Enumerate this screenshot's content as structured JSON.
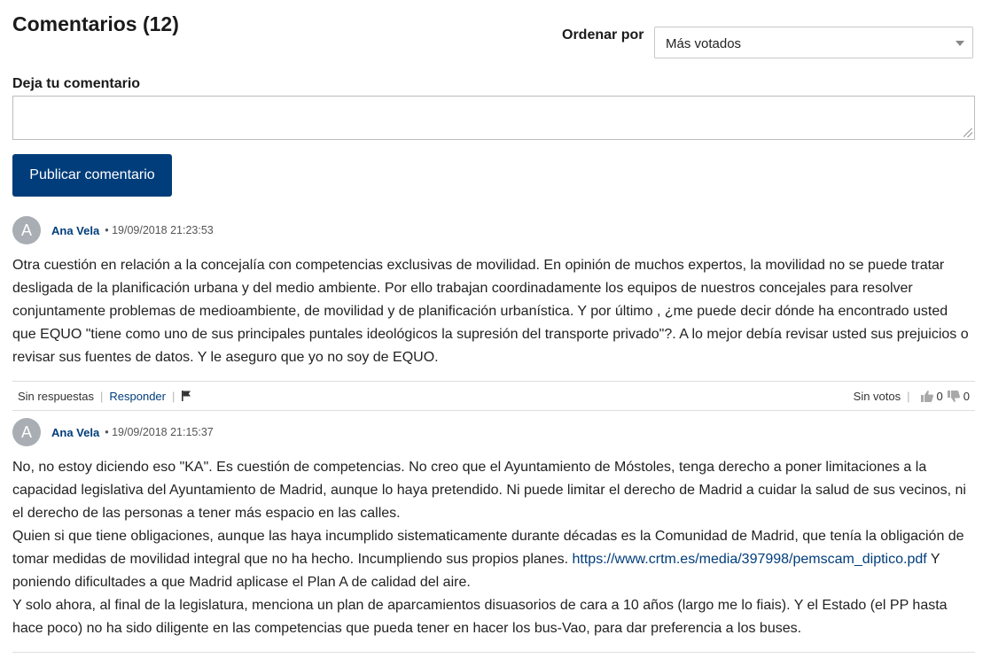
{
  "header": {
    "title": "Comentarios (12)",
    "sort_label": "Ordenar por",
    "sort_value": "Más votados"
  },
  "form": {
    "label": "Deja tu comentario",
    "value": "",
    "submit_label": "Publicar comentario"
  },
  "comments": [
    {
      "avatar_initial": "A",
      "author": "Ana Vela",
      "date": "19/09/2018 21:23:53",
      "body": "Otra cuestión en relación a la concejalía con competencias exclusivas de movilidad. En opinión de muchos expertos, la movilidad no se puede tratar desligada de la planificación urbana y del medio ambiente. Por ello trabajan coordinadamente los equipos de nuestros concejales para resolver conjuntamente problemas de medioambiente, de movilidad y de planificación urbanística. Y por último , ¿me puede decir dónde ha encontrado usted que EQUO \"tiene como uno de sus principales puntales ideológicos la supresión del transporte privado\"?. A lo mejor debía revisar usted sus prejuicios o revisar sus fuentes de datos. Y le aseguro que yo no soy de EQUO.",
      "replies_text": "Sin respuestas",
      "reply_label": "Responder",
      "votes_text": "Sin votos",
      "likes": "0",
      "dislikes": "0"
    },
    {
      "avatar_initial": "A",
      "author": "Ana Vela",
      "date": "19/09/2018 21:15:37",
      "body_p1": "No, no estoy diciendo eso \"KA\". Es cuestión de competencias. No creo que el Ayuntamiento de Móstoles, tenga derecho a poner limitaciones a la capacidad legislativa del Ayuntamiento de Madrid, aunque lo haya pretendido. Ni puede limitar el derecho de Madrid a cuidar la salud de sus vecinos, ni el derecho de las personas a tener más espacio en las calles.",
      "body_p2_before": "Quien si que tiene obligaciones, aunque las haya incumplido sistematicamente durante décadas es la Comunidad de Madrid, que tenía la obligación de tomar medidas de movilidad integral que no ha hecho. Incumpliendo sus propios planes. ",
      "link_text": "https://www.crtm.es/media/397998/pemscam_diptico.pdf",
      "body_p2_after": " Y poniendo dificultades a que Madrid aplicase el Plan A de calidad del aire.",
      "body_p3": "Y solo ahora, al final de la legislatura, menciona un plan de aparcamientos disuasorios de cara a 10 años (largo me lo fiais). Y el Estado (el PP hasta hace poco) no ha sido diligente en las competencias que pueda tener en hacer los bus-Vao, para dar preferencia a los buses."
    }
  ],
  "icons": {
    "flag": "flag-icon",
    "thumbs_up": "thumbs-up-icon",
    "thumbs_down": "thumbs-down-icon",
    "sort_caret": "chevron-down-icon"
  },
  "colors": {
    "brand": "#003d7a",
    "avatar": "#a8aeb3"
  }
}
